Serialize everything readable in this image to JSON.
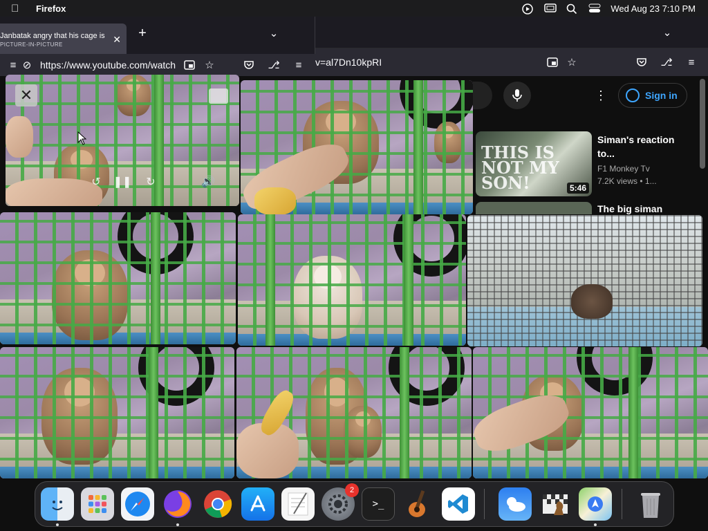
{
  "menubar": {
    "app_name": "Firefox",
    "clock": "Wed Aug 23  7:10 PM"
  },
  "small_window": {
    "tab_title": "Janbatak angry that his cage is",
    "tab_subtitle": "PICTURE-IN-PICTURE",
    "url": "https://www.youtube.com/watch"
  },
  "main_window": {
    "url_tail": "v=al7Dn10kpRI"
  },
  "youtube": {
    "signin_label": "Sign in",
    "recommendations": [
      {
        "title": "Siman's reaction to...",
        "channel": "F1 Monkey Tv",
        "meta": "7.2K views  •  1...",
        "duration": "5:46",
        "thumb_text": "THIS IS NOT MY SON!"
      },
      {
        "title": "The big siman"
      }
    ]
  },
  "pip": {
    "close_icon": "close-icon",
    "controls": [
      "rewind-icon",
      "pause-icon",
      "forward-icon",
      "volume-icon"
    ]
  },
  "dock": {
    "apps": [
      {
        "name": "Finder",
        "running": true
      },
      {
        "name": "Launchpad"
      },
      {
        "name": "Safari"
      },
      {
        "name": "Firefox",
        "running": true
      },
      {
        "name": "Chrome"
      },
      {
        "name": "App Store"
      },
      {
        "name": "TextEdit"
      },
      {
        "name": "System Settings",
        "badge": "2"
      },
      {
        "name": "Terminal"
      },
      {
        "name": "GarageBand"
      },
      {
        "name": "VS Code"
      },
      {
        "name": "Weather"
      },
      {
        "name": "Chess"
      },
      {
        "name": "Maps",
        "running": true
      },
      {
        "name": "Trash"
      }
    ]
  }
}
